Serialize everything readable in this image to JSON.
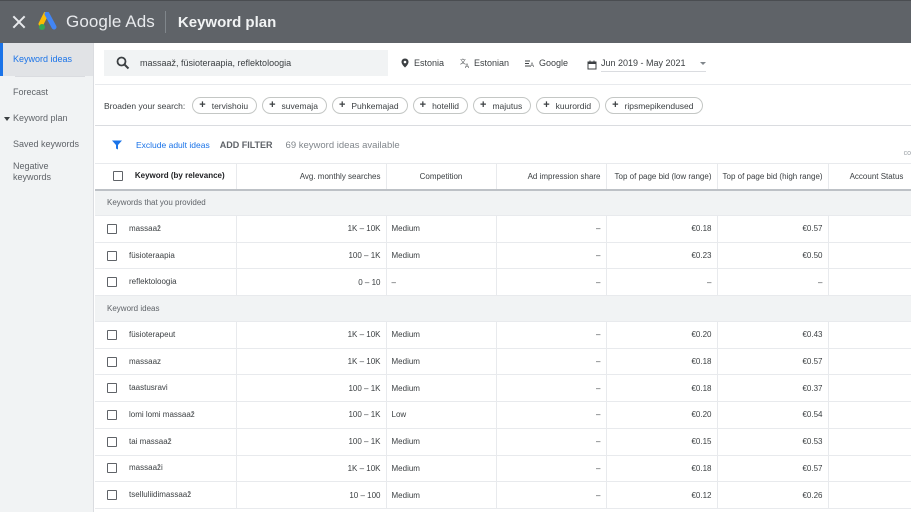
{
  "header": {
    "brand": "Google Ads",
    "page_title": "Keyword plan",
    "logo_colors": {
      "blue": "#4285f4",
      "yellow": "#fbbc04",
      "green": "#34a853"
    }
  },
  "sidebar": {
    "items": [
      {
        "label": "Keyword ideas",
        "active": true
      },
      {
        "label": "Forecast"
      },
      {
        "label": "Keyword plan",
        "expandable": true
      },
      {
        "label": "Saved keywords"
      },
      {
        "label": "Negative keywords"
      }
    ]
  },
  "search": {
    "value": "massaaž, füsioteraapia, reflektoloogia",
    "location": "Estonia",
    "language": "Estonian",
    "network": "Google",
    "date_range": "Jun 2019 - May 2021"
  },
  "broaden": {
    "label": "Broaden your search:",
    "chips": [
      "tervishoiu",
      "suvemaja",
      "Puhkemajad",
      "hotellid",
      "majutus",
      "kuurordid",
      "ripsmepikendused"
    ]
  },
  "filters": {
    "exclude_adult": "Exclude adult ideas",
    "add_filter": "ADD FILTER",
    "count_text": "69 keyword ideas available",
    "edge_text": "co"
  },
  "table": {
    "columns": [
      "Keyword (by relevance)",
      "Avg. monthly searches",
      "Competition",
      "Ad impression share",
      "Top of page bid (low range)",
      "Top of page bid (high range)",
      "Account Status"
    ],
    "groups": [
      {
        "label": "Keywords that you provided",
        "rows": [
          {
            "keyword": "massaaž",
            "searches": "1K – 10K",
            "competition": "Medium",
            "impression_share": "–",
            "bid_low": "€0.18",
            "bid_high": "€0.57",
            "status": ""
          },
          {
            "keyword": "füsioteraapia",
            "searches": "100 – 1K",
            "competition": "Medium",
            "impression_share": "–",
            "bid_low": "€0.23",
            "bid_high": "€0.50",
            "status": ""
          },
          {
            "keyword": "reflektoloogia",
            "searches": "0 – 10",
            "competition": "–",
            "impression_share": "–",
            "bid_low": "–",
            "bid_high": "–",
            "status": ""
          }
        ]
      },
      {
        "label": "Keyword ideas",
        "rows": [
          {
            "keyword": "füsioterapeut",
            "searches": "1K – 10K",
            "competition": "Medium",
            "impression_share": "–",
            "bid_low": "€0.20",
            "bid_high": "€0.43",
            "status": ""
          },
          {
            "keyword": "massaaz",
            "searches": "1K – 10K",
            "competition": "Medium",
            "impression_share": "–",
            "bid_low": "€0.18",
            "bid_high": "€0.57",
            "status": ""
          },
          {
            "keyword": "taastusravi",
            "searches": "100 – 1K",
            "competition": "Medium",
            "impression_share": "–",
            "bid_low": "€0.18",
            "bid_high": "€0.37",
            "status": ""
          },
          {
            "keyword": "lomi lomi massaaž",
            "searches": "100 – 1K",
            "competition": "Low",
            "impression_share": "–",
            "bid_low": "€0.20",
            "bid_high": "€0.54",
            "status": ""
          },
          {
            "keyword": "tai massaaž",
            "searches": "100 – 1K",
            "competition": "Medium",
            "impression_share": "–",
            "bid_low": "€0.15",
            "bid_high": "€0.53",
            "status": ""
          },
          {
            "keyword": "massaaži",
            "searches": "1K – 10K",
            "competition": "Medium",
            "impression_share": "–",
            "bid_low": "€0.18",
            "bid_high": "€0.57",
            "status": ""
          },
          {
            "keyword": "tselluliidimassaaž",
            "searches": "10 – 100",
            "competition": "Medium",
            "impression_share": "–",
            "bid_low": "€0.12",
            "bid_high": "€0.26",
            "status": ""
          }
        ]
      }
    ]
  }
}
